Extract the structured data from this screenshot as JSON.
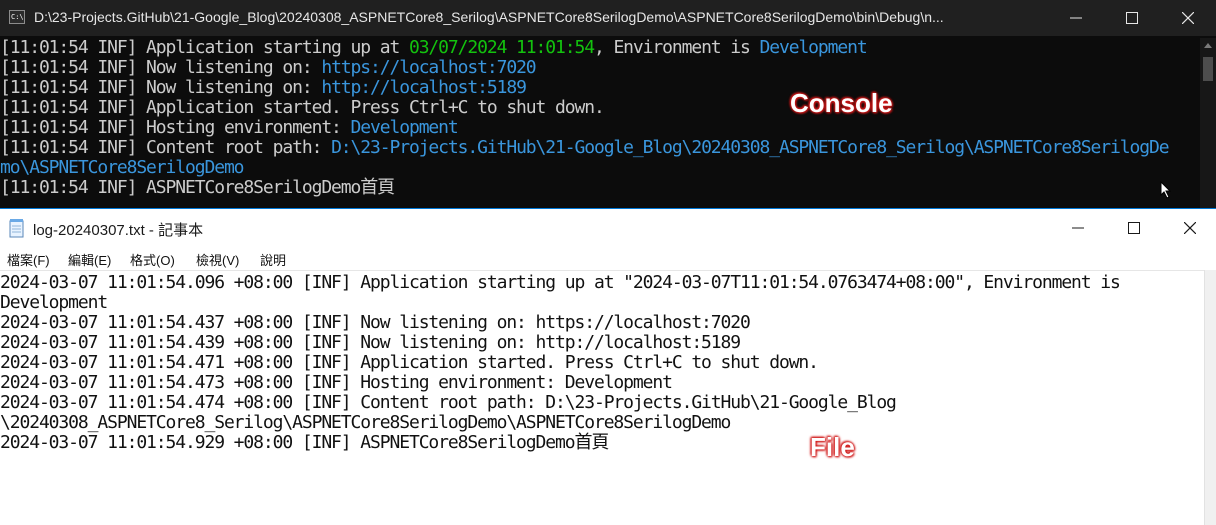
{
  "console": {
    "title": "D:\\23-Projects.GitHub\\21-Google_Blog\\20240308_ASPNETCore8_Serilog\\ASPNETCore8SerilogDemo\\ASPNETCore8SerilogDemo\\bin\\Debug\\n...",
    "icon_text": "C:\\",
    "lines": [
      {
        "a": "[11:01:54 INF] Application starting up at ",
        "b": "03/07/2024 11:01:54",
        "c": ", Environment is ",
        "d": "Development"
      },
      {
        "a": "[11:01:54 INF] Now listening on: ",
        "b": "https://localhost:7020"
      },
      {
        "a": "[11:01:54 INF] Now listening on: ",
        "b": "http://localhost:5189"
      },
      {
        "a": "[11:01:54 INF] Application started. Press Ctrl+C to shut down."
      },
      {
        "a": "[11:01:54 INF] Hosting environment: ",
        "b": "Development"
      },
      {
        "a": "[11:01:54 INF] Content root path: ",
        "b": "D:\\23-Projects.GitHub\\21-Google_Blog\\20240308_ASPNETCore8_Serilog\\ASPNETCore8SerilogDe"
      },
      {
        "a": "mo\\ASPNETCore8SerilogDemo"
      },
      {
        "a": "[11:01:54 INF] ASPNETCore8SerilogDemo首頁"
      }
    ],
    "annotation": "Console"
  },
  "notepad": {
    "title": "log-20240307.txt - 記事本",
    "menu": [
      "檔案(F)",
      "編輯(E)",
      "格式(O)",
      "檢視(V)",
      "說明"
    ],
    "lines": [
      "2024-03-07 11:01:54.096 +08:00 [INF] Application starting up at \"2024-03-07T11:01:54.0763474+08:00\", Environment is",
      "Development",
      "2024-03-07 11:01:54.437 +08:00 [INF] Now listening on: https://localhost:7020",
      "2024-03-07 11:01:54.439 +08:00 [INF] Now listening on: http://localhost:5189",
      "2024-03-07 11:01:54.471 +08:00 [INF] Application started. Press Ctrl+C to shut down.",
      "2024-03-07 11:01:54.473 +08:00 [INF] Hosting environment: Development",
      "2024-03-07 11:01:54.474 +08:00 [INF] Content root path: D:\\23-Projects.GitHub\\21-Google_Blog",
      "\\20240308_ASPNETCore8_Serilog\\ASPNETCore8SerilogDemo\\ASPNETCore8SerilogDemo",
      "2024-03-07 11:01:54.929 +08:00 [INF] ASPNETCore8SerilogDemo首頁"
    ],
    "annotation": "File"
  },
  "colors": {
    "console_bg": "#0c0c0c",
    "console_text": "#cccccc",
    "console_green": "#13c20e",
    "console_cyan": "#3a96dd",
    "annotation": "#d01818",
    "notepad_focus_border": "#0078d7"
  },
  "icons": [
    "console-app-icon",
    "minimize-icon",
    "maximize-icon",
    "close-icon",
    "notepad-app-icon",
    "mouse-cursor-icon"
  ]
}
